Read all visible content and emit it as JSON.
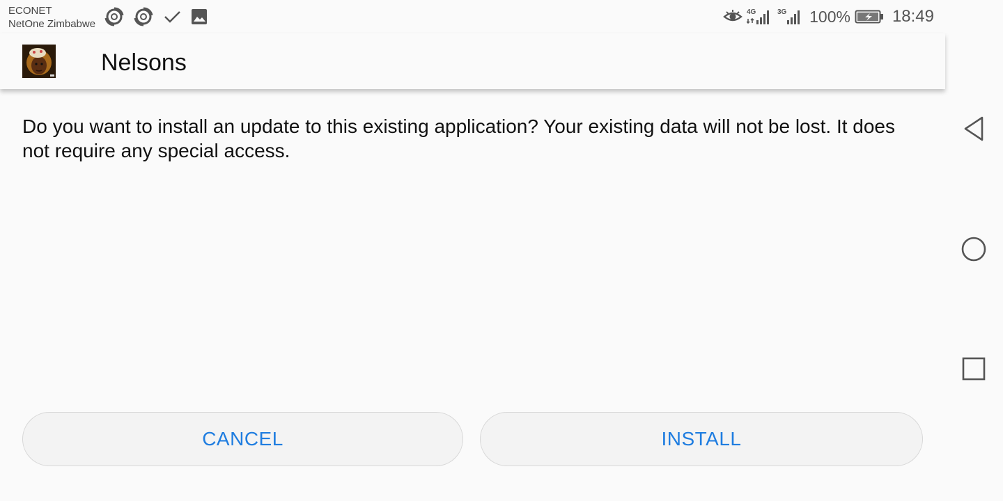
{
  "status_bar": {
    "carrier_1": "ECONET",
    "carrier_2": "NetOne Zimbabwe",
    "notification_icons": [
      "sync-icon",
      "sync-icon",
      "check-icon",
      "image-icon"
    ],
    "status_icons": [
      "eye-icon",
      "signal-4g-icon",
      "signal-3g-icon",
      "battery-charging-icon"
    ],
    "network_1": "4G",
    "network_2": "3G",
    "battery": "100%",
    "time": "18:49"
  },
  "header": {
    "app_name": "Nelsons"
  },
  "dialog": {
    "message": "Do you want to install an update to this existing application? Your existing data will not be lost. It does not require any special access.",
    "cancel_label": "CANCEL",
    "install_label": "INSTALL"
  },
  "nav_bar": {
    "icons": [
      "back-icon",
      "home-icon",
      "recents-icon"
    ]
  },
  "colors": {
    "accent": "#1f7de0",
    "background": "#fafafa",
    "button_bg": "#f3f3f3"
  }
}
